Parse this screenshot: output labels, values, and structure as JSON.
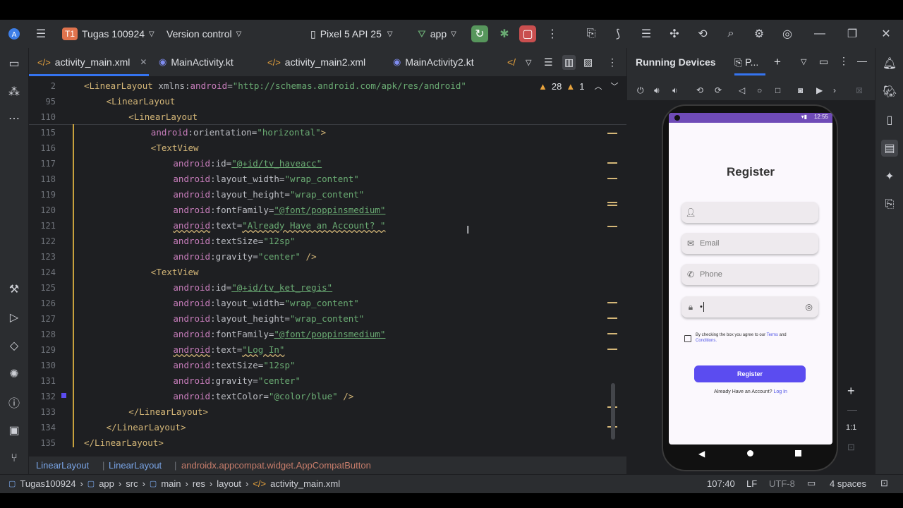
{
  "topbar": {
    "project_badge": "T1",
    "project_name": "Tugas 100924",
    "vcs": "Version control",
    "device": "Pixel 5 API 25",
    "run_config": "app"
  },
  "tabs": [
    {
      "label": "activity_main.xml",
      "active": true
    },
    {
      "label": "MainActivity.kt",
      "active": false
    },
    {
      "label": "activity_main2.xml",
      "active": false
    },
    {
      "label": "MainActivity2.kt",
      "active": false
    }
  ],
  "editor": {
    "warnings": "28",
    "weak_warnings": "1",
    "sticky_lines": [
      {
        "num": "2",
        "indent": 0,
        "tag": "<LinearLayout",
        "rest_attr": " xmlns:",
        "ns": "android",
        "eq": "=",
        "val": "\"http://schemas.android.com/apk/res/android\""
      },
      {
        "num": "95",
        "indent": 1,
        "tag": "<LinearLayout"
      },
      {
        "num": "110",
        "indent": 2,
        "tag": "<LinearLayout"
      }
    ],
    "lines": [
      {
        "num": "115",
        "indent": 3,
        "ns": "android",
        "attr": ":orientation=",
        "val": "\"horizontal\"",
        "close": ">"
      },
      {
        "num": "116",
        "indent": 3,
        "tag": "<TextView"
      },
      {
        "num": "117",
        "indent": 4,
        "ns": "android",
        "attr": ":id=",
        "val": "\"@+id/tv_haveacc\""
      },
      {
        "num": "118",
        "indent": 4,
        "ns": "android",
        "attr": ":layout_width=",
        "val": "\"wrap_content\""
      },
      {
        "num": "119",
        "indent": 4,
        "ns": "android",
        "attr": ":layout_height=",
        "val": "\"wrap_content\""
      },
      {
        "num": "120",
        "indent": 4,
        "ns": "android",
        "attr": ":fontFamily=",
        "val": "\"@font/poppinsmedium\""
      },
      {
        "num": "121",
        "indent": 4,
        "ns": "android",
        "attr": ":text=",
        "val": "\"Already Have an Account? \""
      },
      {
        "num": "122",
        "indent": 4,
        "ns": "android",
        "attr": ":textSize=",
        "val": "\"12sp\""
      },
      {
        "num": "123",
        "indent": 4,
        "ns": "android",
        "attr": ":gravity=",
        "val": "\"center\"",
        "close": " />"
      },
      {
        "num": "124",
        "indent": 3,
        "tag": "<TextView"
      },
      {
        "num": "125",
        "indent": 4,
        "ns": "android",
        "attr": ":id=",
        "val": "\"@+id/tv_ket_regis\""
      },
      {
        "num": "126",
        "indent": 4,
        "ns": "android",
        "attr": ":layout_width=",
        "val": "\"wrap_content\""
      },
      {
        "num": "127",
        "indent": 4,
        "ns": "android",
        "attr": ":layout_height=",
        "val": "\"wrap_content\""
      },
      {
        "num": "128",
        "indent": 4,
        "ns": "android",
        "attr": ":fontFamily=",
        "val": "\"@font/poppinsmedium\""
      },
      {
        "num": "129",
        "indent": 4,
        "ns": "android",
        "attr": ":text=",
        "val": "\"Log In\""
      },
      {
        "num": "130",
        "indent": 4,
        "ns": "android",
        "attr": ":textSize=",
        "val": "\"12sp\""
      },
      {
        "num": "131",
        "indent": 4,
        "ns": "android",
        "attr": ":gravity=",
        "val": "\"center\""
      },
      {
        "num": "132",
        "indent": 4,
        "ns": "android",
        "attr": ":textColor=",
        "val": "\"@color/blue\"",
        "close": " />"
      },
      {
        "num": "133",
        "indent": 2,
        "tag": "</LinearLayout>"
      },
      {
        "num": "134",
        "indent": 1,
        "tag": "</LinearLayout>"
      },
      {
        "num": "135",
        "indent": 0,
        "tag": "</LinearLayout>"
      }
    ]
  },
  "breadcrumb": [
    "LinearLayout",
    "LinearLayout",
    "androidx.appcompat.widget.AppCompatButton"
  ],
  "statusbar": {
    "path": [
      "Tugas100924",
      "app",
      "src",
      "main",
      "res",
      "layout",
      "activity_main.xml"
    ],
    "position": "107:40",
    "line_sep": "LF",
    "encoding": "UTF-8",
    "indent": "4 spaces"
  },
  "running_devices": {
    "title": "Running Devices",
    "tab_label": "P...",
    "zoom_label": "1:1"
  },
  "phone": {
    "time": "12:55",
    "screen_title": "Register",
    "name_placeholder": "",
    "email_placeholder": "Email",
    "phone_placeholder": "Phone",
    "password_value": "•",
    "terms_prefix": "By checking the box you agree to our ",
    "terms_link1": "Terms",
    "terms_and": " and",
    "terms_link2": "Conditions.",
    "register_button": "Register",
    "have_account": "Already Have an Account? ",
    "login_link": "Log In"
  },
  "colors": {
    "accent": "#5b4cf0",
    "editor_bg": "#1e1f22",
    "chrome_bg": "#2b2d30"
  }
}
